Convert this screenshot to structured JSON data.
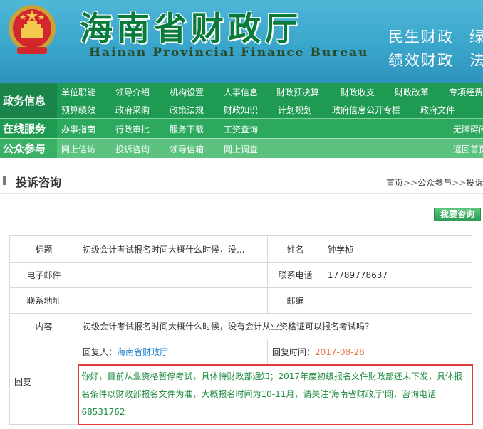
{
  "header": {
    "title": "海南省财政厅",
    "subtitle": "Hainan Provincial Finance Bureau",
    "slogans": [
      "民生财政",
      "绩效财政"
    ],
    "slogan_tails": [
      "绿",
      "法"
    ]
  },
  "nav": {
    "rows": [
      {
        "label": "政务信息",
        "items_row1": [
          "单位职能",
          "领导介绍",
          "机构设置",
          "人事信息",
          "财政预决算",
          "财政收支",
          "财政改革",
          "专项经费"
        ],
        "items_row2": [
          "预算绩效",
          "政府采购",
          "政策法规",
          "财政知识",
          "计划规划",
          "政府信息公开专栏",
          "政府文件"
        ]
      },
      {
        "label": "在线服务",
        "items": [
          "办事指南",
          "行政审批",
          "服务下载",
          "工资查询"
        ],
        "right": "无障碍阅"
      },
      {
        "label": "公众参与",
        "items": [
          "网上信访",
          "投诉咨询",
          "领导信箱",
          "网上调查"
        ],
        "right": "返回首页"
      }
    ]
  },
  "page": {
    "title": "投诉咨询",
    "breadcrumb": [
      "首页",
      "公众参与",
      "投诉咨"
    ],
    "breadcrumb_sep": ">>",
    "ask_button": "我要咨询"
  },
  "record": {
    "title_label": "标题",
    "title_value": "初级会计考试报名时间大概什么时候，没...",
    "name_label": "姓名",
    "name_value": "钟学桢",
    "email_label": "电子邮件",
    "email_value": "",
    "phone_label": "联系电话",
    "phone_value": "17789778637",
    "address_label": "联系地址",
    "address_value": "",
    "zip_label": "邮编",
    "zip_value": "",
    "content_label": "内容",
    "content_value": "初级会计考试报名时间大概什么时候，没有会计从业资格证可以报名考试吗？",
    "reply_label": "回复",
    "replier_label": "回复人：",
    "replier_value": "海南省财政厅",
    "reply_time_label": "回复时间：",
    "reply_time_value": "2017-08-28",
    "reply_content": "你好，目前从业资格暂停考试，具体待财政部通知；2017年度初级报名文件财政部还未下发，具体报名条件以财政部报名文件为准，大概报名时间为10-11月，请关注'海南省财政厅'网，咨询电话68531762"
  },
  "colors": {
    "banner": "#3aa6cb",
    "nav_dark": "#1f9a53",
    "nav_mid": "#2ca95f",
    "nav_light": "#5cc27f",
    "title_green": "#0a7a39",
    "reply_text": "#1d8a3c",
    "reply_border": "#e23b3b",
    "date_orange": "#e6744a",
    "link_blue": "#1a7fd0"
  }
}
